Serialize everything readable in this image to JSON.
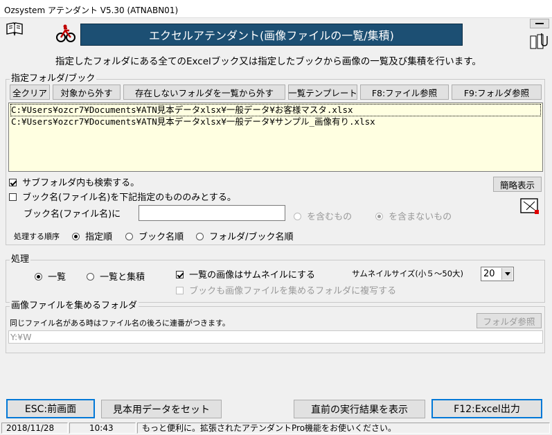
{
  "window": {
    "title": "Ozsystem アテンダント V5.30 (ATNABN01)"
  },
  "banner": {
    "title": "エクセルアテンダント(画像ファイルの一覧/集積)",
    "bg_color": "#1c4f73"
  },
  "description": "指定したフォルダにある全てのExcelブック又は指定したブックから画像の一覧及び集積を行います。",
  "folder_section": {
    "title": "指定フォルダ/ブック",
    "toolbar": {
      "clear": "全クリア",
      "remove": "対象から外す",
      "remove_missing": "存在しないフォルダを一覧から外す",
      "template": "一覧テンプレート",
      "file_ref": "F8:ファイル参照",
      "folder_ref": "F9:フォルダ参照"
    },
    "list": [
      "C:¥Users¥ozcr7¥Documents¥ATN見本データxlsx¥一般データ¥お客様マスタ.xlsx",
      "C:¥Users¥ozcr7¥Documents¥ATN見本データxlsx¥一般データ¥サンプル_画像有り.xlsx"
    ],
    "list_bg": "#ffffe1",
    "subfolder_label": "サブフォルダ内も検索する。",
    "subfolder_checked": true,
    "book_only_label": "ブック名(ファイル名)を下記指定のもののみとする。",
    "book_only_checked": false,
    "book_name_label": "ブック名(ファイル名)に",
    "book_name_value": "",
    "contains": "を含むもの",
    "not_contains": "を含まないもの",
    "simple_view": "簡略表示",
    "order_label": "処理する順序",
    "order_options": [
      "指定順",
      "ブック名順",
      "フォルダ/ブック名順"
    ],
    "order_selected": "指定順"
  },
  "process_section": {
    "title": "処理",
    "mode_options": [
      "一覧",
      "一覧と集積"
    ],
    "mode_selected": "一覧",
    "thumbnail_label": "一覧の画像はサムネイルにする",
    "thumbnail_checked": true,
    "thumb_size_label": "サムネイルサイズ(小５～50大)",
    "thumb_size_value": "20",
    "copy_book_label": "ブックも画像ファイルを集めるフォルダに複写する",
    "copy_book_checked": false
  },
  "collect_section": {
    "title": "画像ファイルを集めるフォルダ",
    "note": "同じファイル名がある時はファイル名の後ろに連番がつきます。",
    "folder_ref": "フォルダ参照",
    "path": "Y:¥W"
  },
  "bottom": {
    "esc": "ESC:前画面",
    "sample": "見本用データをセット",
    "last_result": "直前の実行結果を表示",
    "f12": "F12:Excel出力"
  },
  "statusbar": {
    "date": "2018/11/28",
    "time": "10:43",
    "message": "もっと便利に。拡張されたアテンダントPro機能をお使いください。"
  }
}
